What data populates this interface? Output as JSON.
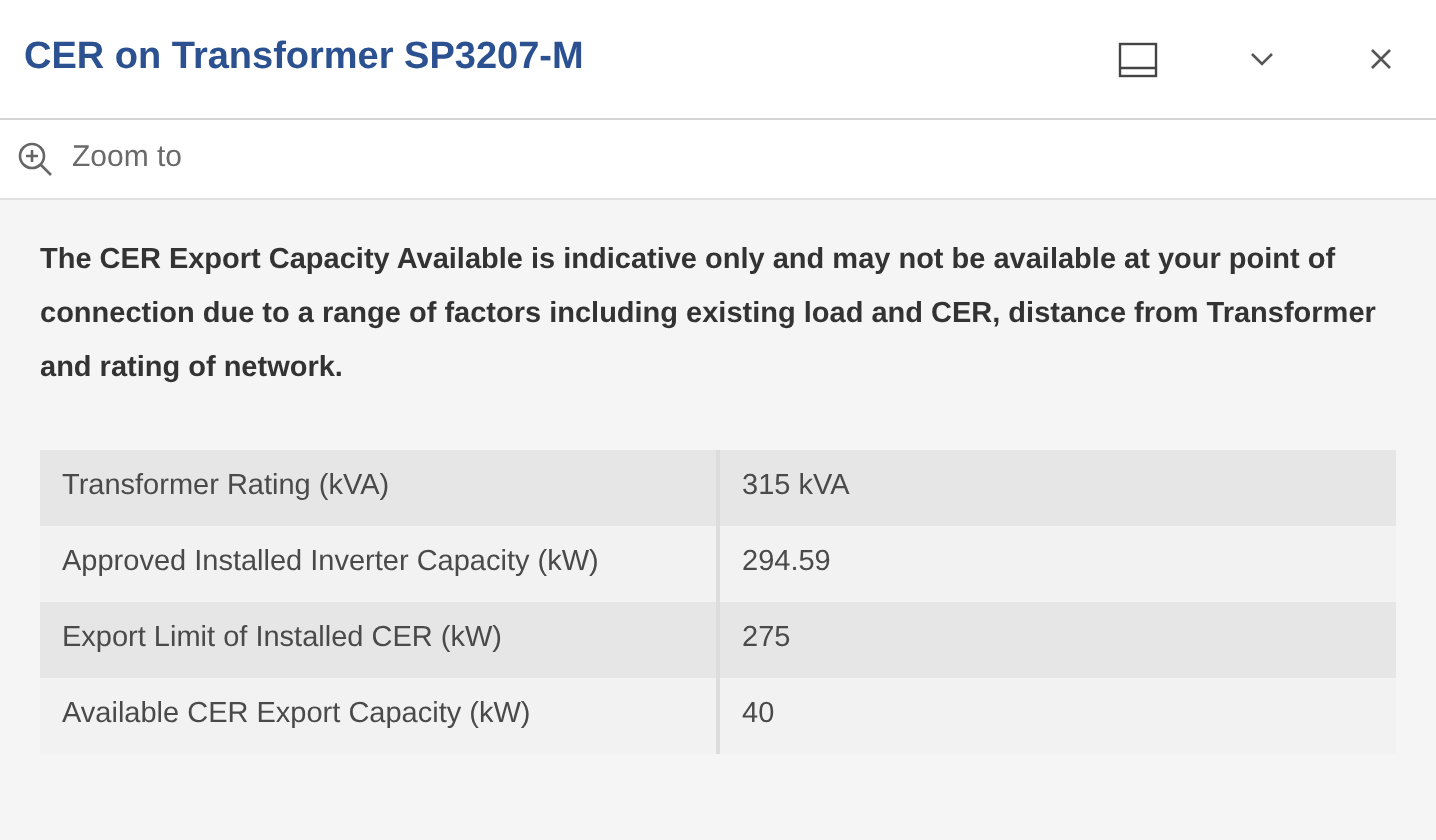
{
  "window": {
    "title": "CER on Transformer SP3207-M"
  },
  "actions": [
    {
      "label": "Zoom to"
    }
  ],
  "notice": "The CER Export Capacity Available is indicative only and may not be available at your point of connection due to a range of factors including existing load and CER, distance from Transformer and rating of network.",
  "table": {
    "rows": [
      {
        "label": "Transformer Rating (kVA)",
        "value": "315 kVA"
      },
      {
        "label": "Approved Installed Inverter Capacity (kW)",
        "value": "294.59"
      },
      {
        "label": "Export Limit of Installed CER (kW)",
        "value": "275"
      },
      {
        "label": "Available CER Export Capacity (kW)",
        "value": "40"
      }
    ]
  }
}
